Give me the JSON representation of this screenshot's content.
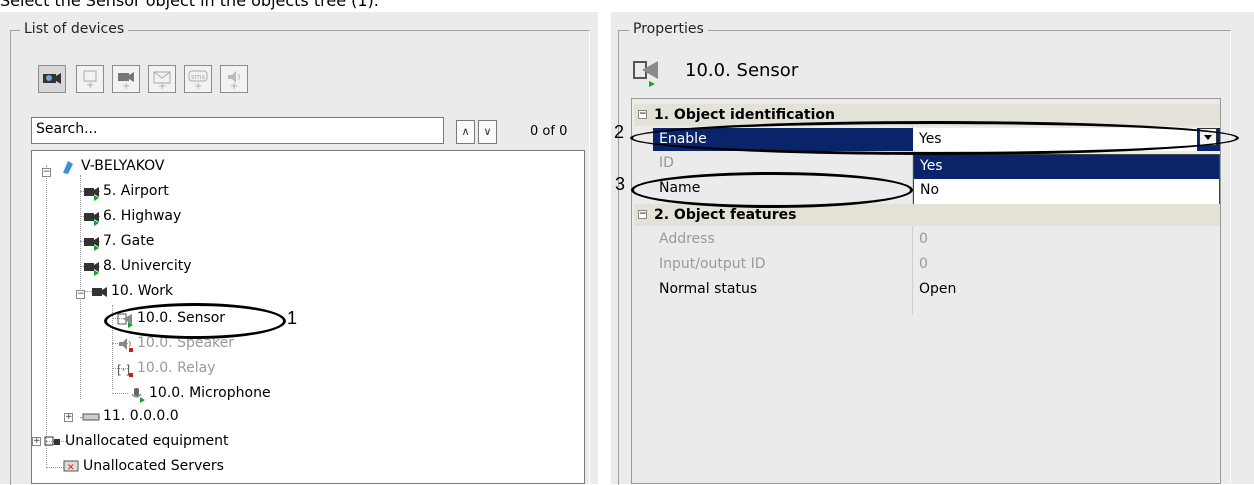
{
  "caption": "Select the Sensor object in the objects tree (1).",
  "left_panel": {
    "title": "List of devices",
    "toolbar": [
      {
        "name": "camera-search-icon"
      },
      {
        "name": "add-sensor-icon"
      },
      {
        "name": "add-camera-icon"
      },
      {
        "name": "add-email-icon"
      },
      {
        "name": "add-sms-icon"
      },
      {
        "name": "add-speaker-icon"
      }
    ],
    "search_placeholder": "Search...",
    "counter": "0 of 0",
    "tree": [
      {
        "label": "V-BELYAKOV"
      },
      {
        "label": "5. Airport"
      },
      {
        "label": "6. Highway"
      },
      {
        "label": "7. Gate"
      },
      {
        "label": "8. Univercity"
      },
      {
        "label": "10. Work"
      },
      {
        "label": "10.0. Sensor"
      },
      {
        "label": "10.0. Speaker"
      },
      {
        "label": "10.0. Relay"
      },
      {
        "label": "10.0. Microphone"
      },
      {
        "label": "11. 0.0.0.0"
      },
      {
        "label": "Unallocated equipment"
      },
      {
        "label": "Unallocated Servers"
      }
    ]
  },
  "right_panel": {
    "title": "Properties",
    "object_title": "10.0. Sensor",
    "categories": [
      "1. Object identification",
      "2. Object features"
    ],
    "rows": [
      {
        "key": "Enable",
        "value": "Yes"
      },
      {
        "key": "ID",
        "value": ""
      },
      {
        "key": "Name",
        "value": ""
      },
      {
        "key": "Address",
        "value": "0"
      },
      {
        "key": "Input/output ID",
        "value": "0"
      },
      {
        "key": "Normal status",
        "value": "Open"
      }
    ],
    "dropdown_options": [
      "Yes",
      "No"
    ]
  },
  "callouts": [
    "1",
    "2",
    "3"
  ]
}
